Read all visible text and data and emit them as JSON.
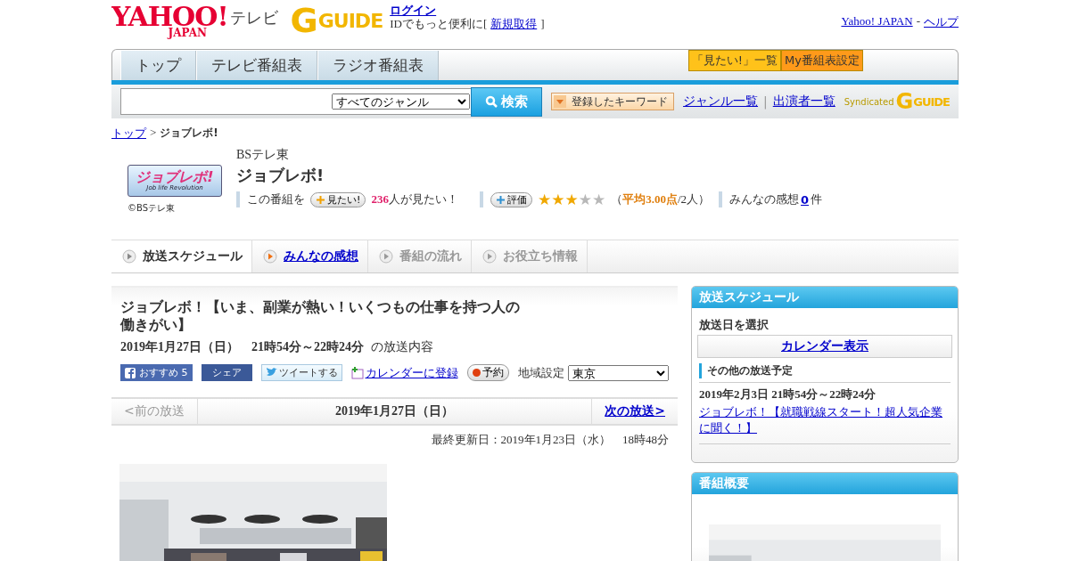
{
  "header": {
    "logo": "YAHOO!",
    "logo_sub": "JAPAN",
    "service": "テレビ",
    "gguide_mark": "G",
    "gguide": "GUIDE",
    "login": "ログイン",
    "id_text": "IDでもっと便利に[",
    "signup": "新規取得",
    "bracket": "]",
    "links": [
      "Yahoo! JAPAN",
      "ヘルプ"
    ],
    "link_separator": "-"
  },
  "nav": {
    "tabs": [
      {
        "label": "トップ",
        "selected": false
      },
      {
        "label": "テレビ番組表",
        "selected": false
      },
      {
        "label": "ラジオ番組表",
        "selected": false
      }
    ],
    "buttons": [
      {
        "label": "「見たい!」一覧",
        "color": "#ffc21a"
      },
      {
        "label": "My番組表設定",
        "color": "#ff9a1a"
      }
    ]
  },
  "search": {
    "genre": "すべてのジャンル",
    "button": "検索",
    "keyword_button": "登録したキーワード",
    "links": [
      "ジャンル一覧",
      "出演者一覧"
    ],
    "link_separator": "|",
    "syndicated": "Syndicated",
    "gguide_mark": "G",
    "gguide": "GUIDE"
  },
  "breadcrumb": {
    "link": "トップ",
    "separator": ">",
    "current": "ジョブレボ!"
  },
  "program": {
    "logo_main": "ジョブレボ!",
    "logo_sub": "Job life Revolution",
    "copyright": "©BSテレ東",
    "channel": "BSテレ東",
    "title": "ジョブレボ!",
    "want_label": "この番組を",
    "want_button": "見たい!",
    "want_count": "236",
    "want_suffix": "人が見たい！",
    "rate_button": "評価",
    "stars": 3,
    "rating": "（**平均3.00点**/2人）",
    "impressions_label": "みんなの感想",
    "impressions_count": "0",
    "impressions_suffix": "件"
  },
  "subtabs": [
    {
      "label": "放送スケジュール",
      "selected": true,
      "disabled": false
    },
    {
      "label": "みんなの感想",
      "selected": false,
      "disabled": false
    },
    {
      "label": "番組の流れ",
      "selected": false,
      "disabled": true
    },
    {
      "label": "お役立ち情報",
      "selected": false,
      "disabled": true
    }
  ],
  "episode": {
    "title": "ジョブレボ！【いま、副業が熱い！いくつもの仕事を持つ人の働きがい】",
    "datetime": "2019年1月27日（日）　21時54分～22時24分",
    "datetime_suffix": "の放送内容",
    "recommend": "おすすめ",
    "recommend_count": "5",
    "share": "シェア",
    "tweet": "ツイートする",
    "calendar": "カレンダーに登録",
    "reserve": "予約",
    "region_label": "地域設定",
    "region": "東京"
  },
  "pager": {
    "prev": "<前の放送",
    "prev_disabled": true,
    "date": "2019年1月27日（日）",
    "next": "次の放送>"
  },
  "updated": "最終更新日：2019年1月23日（水）　18時48分",
  "sidebar": {
    "schedule_title": "放送スケジュール",
    "select_label": "放送日を選択",
    "calendar_button": "カレンダー表示",
    "other_label": "その他の放送予定",
    "entries": [
      {
        "datetime": "2019年2月3日  21時54分～22時24分",
        "title": "ジョブレボ！【就職戦線スタート！超人気企業に聞く！】"
      }
    ],
    "overview_title": "番組概要"
  }
}
